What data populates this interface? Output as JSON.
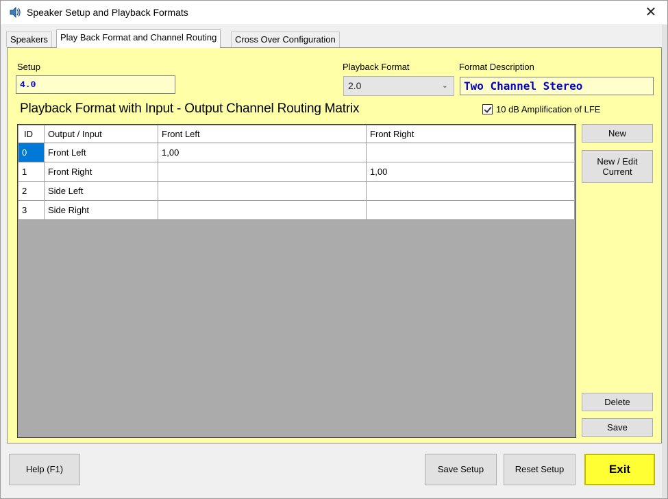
{
  "window": {
    "title": "Speaker Setup and Playback Formats",
    "close_glyph": "✕"
  },
  "tabs": [
    {
      "label": "Speakers",
      "active": false
    },
    {
      "label": "Play Back Format and Channel Routing",
      "active": true
    },
    {
      "label": "Cross Over Configuration",
      "active": false
    }
  ],
  "setup": {
    "label": "Setup",
    "value": "4.0"
  },
  "playback_format": {
    "label": "Playback Format",
    "selected": "2.0"
  },
  "format_description": {
    "label": "Format Description",
    "value": "Two Channel Stereo"
  },
  "matrix": {
    "title": "Playback Format with Input - Output Channel Routing Matrix",
    "lfe_label": "10 dB Amplification of LFE",
    "lfe_checked": true,
    "columns": [
      "ID",
      "Output / Input",
      "Front Left",
      "Front Right"
    ],
    "rows": [
      [
        "0",
        "Front Left",
        "1,00",
        ""
      ],
      [
        "1",
        "Front Right",
        "",
        "1,00"
      ],
      [
        "2",
        "Side Left",
        "",
        ""
      ],
      [
        "3",
        "Side Right",
        "",
        ""
      ]
    ]
  },
  "side_buttons": {
    "new": "New",
    "new_edit_line1": "New / Edit",
    "new_edit_line2": "Current",
    "delete": "Delete",
    "save": "Save"
  },
  "bottom_buttons": {
    "help": "Help (F1)",
    "save_setup": "Save Setup",
    "reset_setup": "Reset Setup",
    "exit": "Exit"
  },
  "colors": {
    "panel_bg": "#ffffa8",
    "field_bg": "#ffffcc",
    "field_text": "#0000c8",
    "selection": "#0078d7",
    "exit_bg": "#ffff33"
  },
  "icons": {
    "app": "speaker-icon",
    "close": "close-icon",
    "dropdown": "chevron-down-icon",
    "checkbox": "checkmark-icon"
  }
}
